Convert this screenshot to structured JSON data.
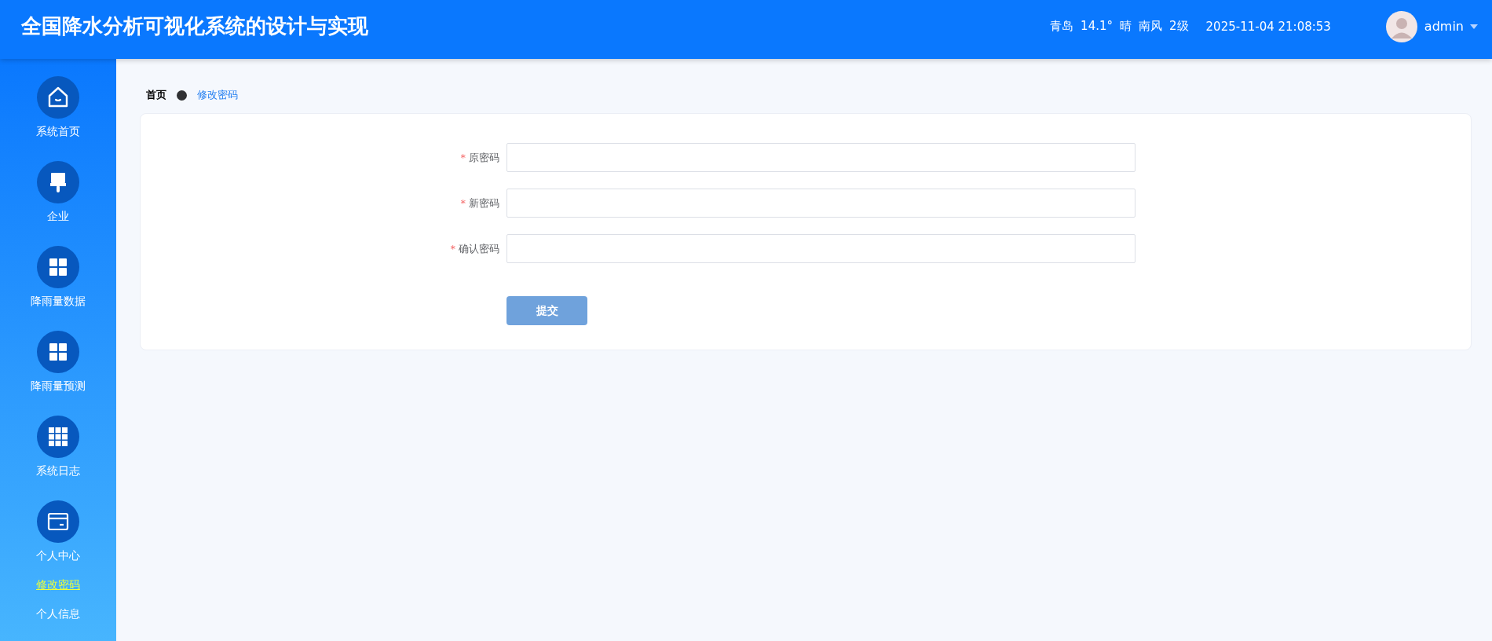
{
  "header": {
    "title": "全国降水分析可视化系统的设计与实现",
    "weather": [
      "青岛",
      "14.1°",
      "晴",
      "南风",
      "2级"
    ],
    "datetime": "2025-11-04 21:08:53",
    "user": "admin"
  },
  "sidebar": {
    "items": [
      {
        "label": "系统首页",
        "kind": "home"
      },
      {
        "label": "企业",
        "kind": "brush"
      },
      {
        "label": "降雨量数据",
        "kind": "grid4"
      },
      {
        "label": "降雨量预测",
        "kind": "grid4"
      },
      {
        "label": "系统日志",
        "kind": "grid9"
      },
      {
        "label": "个人中心",
        "kind": "card",
        "children": [
          {
            "label": "修改密码",
            "selected": true
          },
          {
            "label": "个人信息",
            "selected": false
          }
        ]
      }
    ]
  },
  "breadcrumb": [
    "首页",
    "修改密码"
  ],
  "form": {
    "fields": [
      {
        "label": "原密码",
        "required_mark": "*"
      },
      {
        "label": "新密码",
        "required_mark": "*"
      },
      {
        "label": "确认密码",
        "required_mark": "*"
      }
    ],
    "submit": "提交"
  }
}
